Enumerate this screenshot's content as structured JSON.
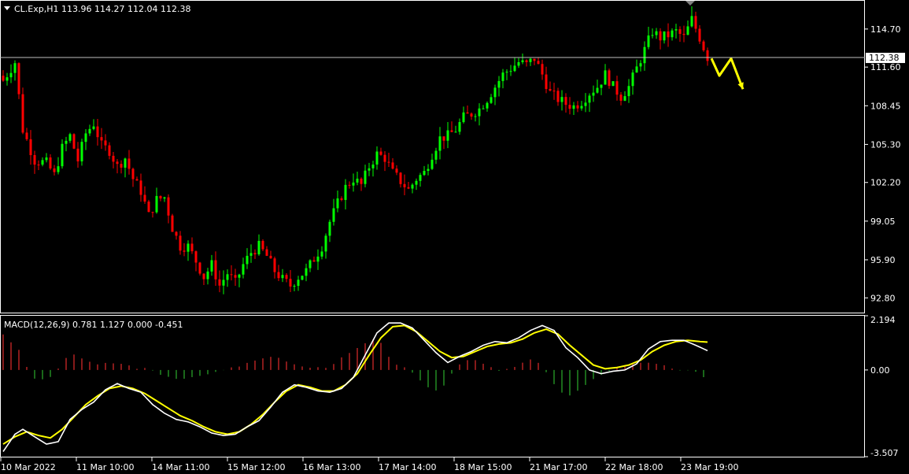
{
  "header": {
    "symbol_line": "CL.Exp,H1  113.96 114.27 112.04 112.38",
    "macd_line": "MACD(12,26,9) 0.781 1.127 0.000 -0.451"
  },
  "colors": {
    "background": "#000000",
    "bull": "#00ff00",
    "bear": "#ff0000",
    "grid_border": "#ffffff",
    "price_line": "#c0c0c0",
    "macd_main": "#ffffff",
    "macd_signal": "#ffff00",
    "hist_pos": "#b22222",
    "hist_neg": "#228b22",
    "arrow": "#ffff00"
  },
  "chart_data": [
    {
      "type": "candlestick",
      "symbol": "CL.Exp",
      "timeframe": "H1",
      "ohlc_last": {
        "open": 113.96,
        "high": 114.27,
        "low": 112.04,
        "close": 112.38
      },
      "ylim": [
        91.6,
        117.0
      ],
      "y_ticks": [
        "114.70",
        "111.60",
        "108.45",
        "105.30",
        "102.20",
        "99.05",
        "95.90",
        "92.80"
      ],
      "current_price": "112.38",
      "x_ticks": [
        "10 Mar 2022",
        "11 Mar 10:00",
        "14 Mar 11:00",
        "15 Mar 12:00",
        "16 Mar 13:00",
        "17 Mar 14:00",
        "18 Mar 15:00",
        "21 Mar 17:00",
        "22 Mar 18:00",
        "23 Mar 19:00"
      ],
      "close_path": [
        [
          0,
          110.5
        ],
        [
          3,
          112.0
        ],
        [
          5,
          106.5
        ],
        [
          8,
          104.0
        ],
        [
          11,
          103.8
        ],
        [
          13,
          102.8
        ],
        [
          15,
          105.0
        ],
        [
          17,
          106.0
        ],
        [
          19,
          104.0
        ],
        [
          21,
          106.2
        ],
        [
          23,
          107.0
        ],
        [
          25,
          105.2
        ],
        [
          27,
          104.8
        ],
        [
          29,
          103.5
        ],
        [
          31,
          104.2
        ],
        [
          33,
          102.5
        ],
        [
          35,
          101.5
        ],
        [
          37,
          99.5
        ],
        [
          39,
          100.8
        ],
        [
          41,
          101.0
        ],
        [
          43,
          98.5
        ],
        [
          45,
          97.0
        ],
        [
          47,
          97.0
        ],
        [
          49,
          95.8
        ],
        [
          51,
          94.5
        ],
        [
          53,
          95.5
        ],
        [
          55,
          93.8
        ],
        [
          57,
          94.8
        ],
        [
          59,
          94.0
        ],
        [
          61,
          95.5
        ],
        [
          63,
          96.5
        ],
        [
          65,
          97.0
        ],
        [
          67,
          96.2
        ],
        [
          69,
          95.0
        ],
        [
          71,
          94.3
        ],
        [
          73,
          93.8
        ],
        [
          75,
          94.5
        ],
        [
          77,
          95.0
        ],
        [
          79,
          96.0
        ],
        [
          81,
          97.0
        ],
        [
          83,
          99.0
        ],
        [
          85,
          100.5
        ],
        [
          87,
          101.8
        ],
        [
          89,
          102.5
        ],
        [
          91,
          102.0
        ],
        [
          93,
          103.5
        ],
        [
          95,
          104.5
        ],
        [
          97,
          104.2
        ],
        [
          99,
          103.0
        ],
        [
          101,
          102.3
        ],
        [
          103,
          101.6
        ],
        [
          105,
          102.5
        ],
        [
          107,
          103.0
        ],
        [
          109,
          104.5
        ],
        [
          111,
          105.8
        ],
        [
          113,
          106.0
        ],
        [
          115,
          106.5
        ],
        [
          117,
          107.5
        ],
        [
          119,
          107.8
        ],
        [
          121,
          108.2
        ],
        [
          123,
          109.0
        ],
        [
          125,
          110.0
        ],
        [
          127,
          111.0
        ],
        [
          129,
          111.5
        ],
        [
          131,
          112.0
        ],
        [
          133,
          111.8
        ],
        [
          135,
          112.3
        ],
        [
          137,
          111.0
        ],
        [
          139,
          109.5
        ],
        [
          141,
          109.0
        ],
        [
          143,
          108.6
        ],
        [
          145,
          108.4
        ],
        [
          147,
          108.8
        ],
        [
          149,
          109.5
        ],
        [
          151,
          110.0
        ],
        [
          153,
          111.0
        ],
        [
          155,
          110.0
        ],
        [
          157,
          109.2
        ],
        [
          159,
          110.0
        ],
        [
          161,
          111.5
        ],
        [
          163,
          113.0
        ],
        [
          165,
          114.5
        ],
        [
          167,
          114.0
        ],
        [
          169,
          114.2
        ],
        [
          171,
          114.5
        ],
        [
          173,
          114.0
        ],
        [
          175,
          115.5
        ],
        [
          177,
          114.0
        ],
        [
          179,
          112.4
        ]
      ],
      "forecast_arrow_path": [
        [
          180,
          112.3
        ],
        [
          182,
          110.9
        ],
        [
          185,
          112.3
        ],
        [
          188,
          109.8
        ]
      ]
    },
    {
      "type": "line",
      "indicator": "MACD",
      "params": "12,26,9",
      "values": {
        "main": 0.781,
        "signal": 1.127,
        "level": 0.0,
        "histogram": -0.451
      },
      "ylim": [
        -3.507,
        2.194
      ],
      "y_ticks": [
        "2.194",
        "0.00",
        "-3.507"
      ],
      "main_path": [
        [
          0,
          -3.3
        ],
        [
          3,
          -2.6
        ],
        [
          5,
          -2.4
        ],
        [
          8,
          -2.7
        ],
        [
          11,
          -3.0
        ],
        [
          14,
          -2.9
        ],
        [
          17,
          -2.0
        ],
        [
          20,
          -1.6
        ],
        [
          23,
          -1.3
        ],
        [
          26,
          -0.8
        ],
        [
          29,
          -0.55
        ],
        [
          32,
          -0.75
        ],
        [
          35,
          -0.9
        ],
        [
          38,
          -1.4
        ],
        [
          41,
          -1.75
        ],
        [
          44,
          -2.0
        ],
        [
          47,
          -2.1
        ],
        [
          50,
          -2.3
        ],
        [
          53,
          -2.55
        ],
        [
          56,
          -2.65
        ],
        [
          59,
          -2.6
        ],
        [
          62,
          -2.3
        ],
        [
          65,
          -2.05
        ],
        [
          68,
          -1.5
        ],
        [
          71,
          -0.9
        ],
        [
          74,
          -0.6
        ],
        [
          77,
          -0.7
        ],
        [
          80,
          -0.85
        ],
        [
          83,
          -0.9
        ],
        [
          86,
          -0.75
        ],
        [
          89,
          -0.3
        ],
        [
          92,
          0.6
        ],
        [
          95,
          1.5
        ],
        [
          98,
          1.9
        ],
        [
          101,
          1.9
        ],
        [
          104,
          1.7
        ],
        [
          107,
          1.2
        ],
        [
          110,
          0.7
        ],
        [
          113,
          0.3
        ],
        [
          116,
          0.55
        ],
        [
          119,
          0.75
        ],
        [
          122,
          1.0
        ],
        [
          125,
          1.15
        ],
        [
          128,
          1.1
        ],
        [
          131,
          1.3
        ],
        [
          134,
          1.6
        ],
        [
          137,
          1.8
        ],
        [
          140,
          1.6
        ],
        [
          143,
          0.9
        ],
        [
          146,
          0.5
        ],
        [
          149,
          0.0
        ],
        [
          152,
          -0.15
        ],
        [
          155,
          -0.05
        ],
        [
          158,
          0.0
        ],
        [
          161,
          0.25
        ],
        [
          164,
          0.85
        ],
        [
          167,
          1.15
        ],
        [
          170,
          1.2
        ],
        [
          173,
          1.2
        ],
        [
          176,
          1.0
        ],
        [
          179,
          0.781
        ]
      ],
      "signal_path": [
        [
          0,
          -3.0
        ],
        [
          3,
          -2.7
        ],
        [
          6,
          -2.5
        ],
        [
          9,
          -2.65
        ],
        [
          12,
          -2.75
        ],
        [
          15,
          -2.4
        ],
        [
          18,
          -1.9
        ],
        [
          21,
          -1.4
        ],
        [
          24,
          -1.05
        ],
        [
          27,
          -0.75
        ],
        [
          30,
          -0.65
        ],
        [
          33,
          -0.75
        ],
        [
          36,
          -0.95
        ],
        [
          39,
          -1.25
        ],
        [
          42,
          -1.55
        ],
        [
          45,
          -1.85
        ],
        [
          48,
          -2.05
        ],
        [
          51,
          -2.3
        ],
        [
          54,
          -2.5
        ],
        [
          57,
          -2.6
        ],
        [
          60,
          -2.5
        ],
        [
          63,
          -2.2
        ],
        [
          66,
          -1.8
        ],
        [
          69,
          -1.3
        ],
        [
          72,
          -0.85
        ],
        [
          75,
          -0.6
        ],
        [
          78,
          -0.7
        ],
        [
          81,
          -0.85
        ],
        [
          84,
          -0.85
        ],
        [
          87,
          -0.6
        ],
        [
          90,
          -0.15
        ],
        [
          93,
          0.6
        ],
        [
          96,
          1.3
        ],
        [
          99,
          1.75
        ],
        [
          102,
          1.8
        ],
        [
          105,
          1.55
        ],
        [
          108,
          1.15
        ],
        [
          111,
          0.75
        ],
        [
          114,
          0.5
        ],
        [
          117,
          0.55
        ],
        [
          120,
          0.75
        ],
        [
          123,
          0.95
        ],
        [
          126,
          1.05
        ],
        [
          129,
          1.1
        ],
        [
          132,
          1.25
        ],
        [
          135,
          1.5
        ],
        [
          138,
          1.65
        ],
        [
          141,
          1.45
        ],
        [
          144,
          1.0
        ],
        [
          147,
          0.6
        ],
        [
          150,
          0.2
        ],
        [
          153,
          0.05
        ],
        [
          156,
          0.1
        ],
        [
          159,
          0.2
        ],
        [
          162,
          0.4
        ],
        [
          165,
          0.75
        ],
        [
          168,
          1.0
        ],
        [
          171,
          1.15
        ],
        [
          174,
          1.2
        ],
        [
          177,
          1.15
        ],
        [
          179,
          1.127
        ]
      ],
      "histogram_path": [
        [
          0,
          1.45
        ],
        [
          3,
          1.0
        ],
        [
          5,
          0.6
        ],
        [
          7,
          -0.3
        ],
        [
          10,
          -0.35
        ],
        [
          13,
          -0.2
        ],
        [
          15,
          0.3
        ],
        [
          17,
          0.7
        ],
        [
          19,
          0.55
        ],
        [
          21,
          0.45
        ],
        [
          23,
          0.2
        ],
        [
          25,
          0.2
        ],
        [
          27,
          0.3
        ],
        [
          29,
          0.25
        ],
        [
          31,
          0.25
        ],
        [
          33,
          0.1
        ],
        [
          35,
          0.05
        ],
        [
          37,
          0.05
        ],
        [
          39,
          -0.1
        ],
        [
          41,
          -0.25
        ],
        [
          43,
          -0.3
        ],
        [
          45,
          -0.35
        ],
        [
          47,
          -0.3
        ],
        [
          49,
          -0.3
        ],
        [
          51,
          -0.2
        ],
        [
          53,
          -0.1
        ],
        [
          55,
          -0.1
        ],
        [
          57,
          0.05
        ],
        [
          59,
          0.1
        ],
        [
          61,
          0.2
        ],
        [
          63,
          0.35
        ],
        [
          65,
          0.4
        ],
        [
          67,
          0.5
        ],
        [
          69,
          0.5
        ],
        [
          71,
          0.45
        ],
        [
          73,
          0.25
        ],
        [
          75,
          0.15
        ],
        [
          77,
          0.1
        ],
        [
          79,
          0.05
        ],
        [
          81,
          0.1
        ],
        [
          83,
          0.15
        ],
        [
          85,
          0.4
        ],
        [
          87,
          0.6
        ],
        [
          89,
          0.7
        ],
        [
          91,
          1.0
        ],
        [
          93,
          1.2
        ],
        [
          95,
          1.35
        ],
        [
          97,
          0.8
        ],
        [
          99,
          0.3
        ],
        [
          101,
          0.1
        ],
        [
          103,
          0.05
        ],
        [
          105,
          -0.2
        ],
        [
          107,
          -0.6
        ],
        [
          109,
          -0.85
        ],
        [
          111,
          -0.75
        ],
        [
          113,
          -0.45
        ],
        [
          115,
          0.1
        ],
        [
          117,
          0.3
        ],
        [
          119,
          0.45
        ],
        [
          121,
          0.35
        ],
        [
          123,
          0.15
        ],
        [
          125,
          0.05
        ],
        [
          127,
          -0.05
        ],
        [
          129,
          0.1
        ],
        [
          131,
          0.2
        ],
        [
          133,
          0.45
        ],
        [
          135,
          0.35
        ],
        [
          137,
          0.2
        ],
        [
          139,
          -0.3
        ],
        [
          141,
          -0.8
        ],
        [
          143,
          -1.05
        ],
        [
          145,
          -0.95
        ],
        [
          147,
          -0.7
        ],
        [
          149,
          -0.5
        ],
        [
          151,
          -0.3
        ],
        [
          153,
          -0.1
        ],
        [
          155,
          0.0
        ],
        [
          157,
          0.1
        ],
        [
          159,
          0.2
        ],
        [
          161,
          0.3
        ],
        [
          163,
          0.35
        ],
        [
          165,
          0.3
        ],
        [
          167,
          0.25
        ],
        [
          169,
          0.15
        ],
        [
          171,
          0.0
        ],
        [
          173,
          -0.05
        ],
        [
          175,
          0.1
        ],
        [
          177,
          -0.2
        ],
        [
          179,
          -0.451
        ]
      ]
    }
  ]
}
